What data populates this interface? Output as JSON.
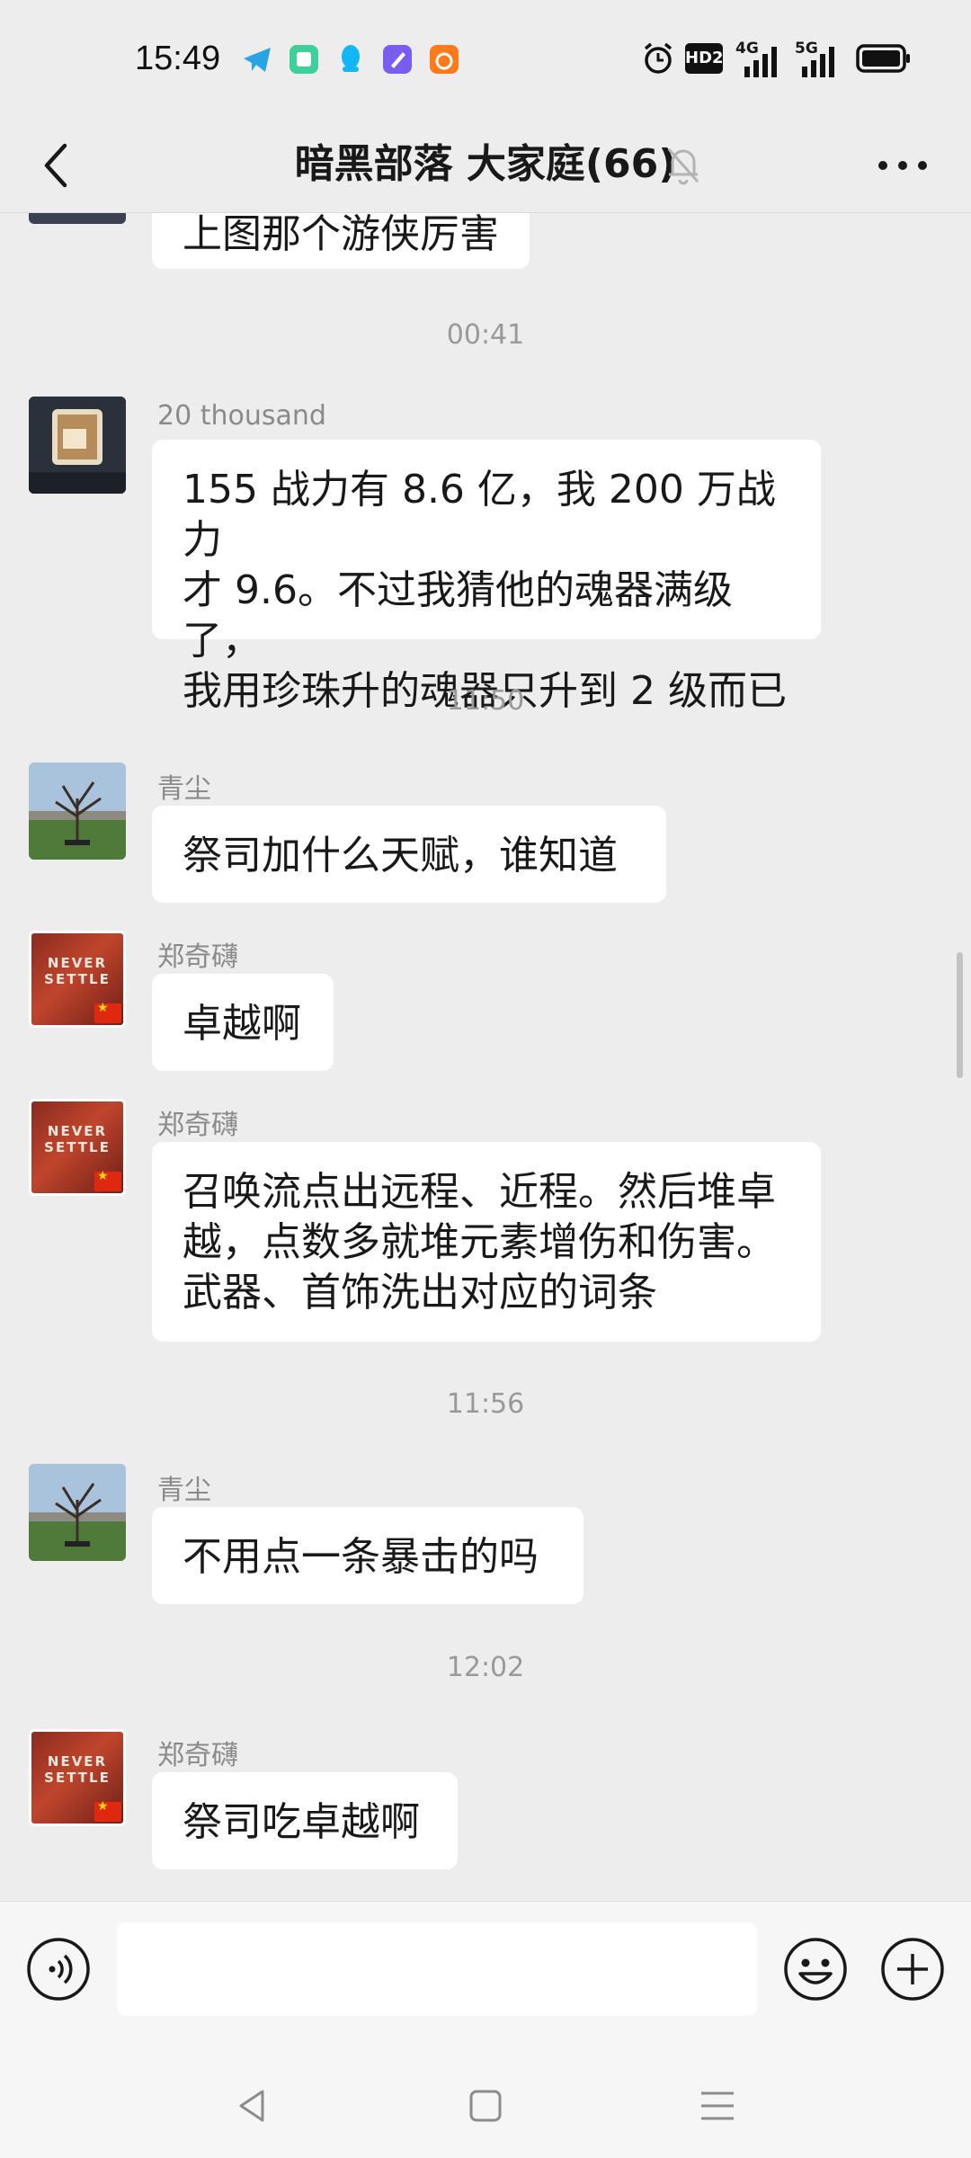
{
  "status_bar": {
    "time": "15:49",
    "hd_label": "HD2",
    "net1": "4G",
    "net2": "5G"
  },
  "header": {
    "title": "暗黑部落 大家庭(66)",
    "back_icon": "chevron-left-icon",
    "mute_icon": "bell-off-icon",
    "more_icon": "more-dots-icon"
  },
  "messages": [
    {
      "type": "text",
      "sender": "",
      "text": "上图那个游侠厉害"
    },
    {
      "type": "time",
      "text": "00:41"
    },
    {
      "type": "text",
      "sender": "20 thousand",
      "text": "155 战力有 8.6 亿，我 200 万战力\n才 9.6。不过我猜他的魂器满级了，\n我用珍珠升的魂器只升到 2 级而已"
    },
    {
      "type": "time",
      "text": "11:50"
    },
    {
      "type": "text",
      "sender": "青尘",
      "text": "祭司加什么天赋，谁知道"
    },
    {
      "type": "text",
      "sender": "郑奇礴",
      "text": "卓越啊"
    },
    {
      "type": "text",
      "sender": "郑奇礴",
      "text": "召唤流点出远程、近程。然后堆卓\n越，点数多就堆元素增伤和伤害。\n武器、首饰洗出对应的词条"
    },
    {
      "type": "time",
      "text": "11:56"
    },
    {
      "type": "text",
      "sender": "青尘",
      "text": "不用点一条暴击的吗"
    },
    {
      "type": "time",
      "text": "12:02"
    },
    {
      "type": "text",
      "sender": "郑奇礴",
      "text": "祭司吃卓越啊"
    }
  ],
  "avatar_text": {
    "line1": "NEVER",
    "line2": "SETTLE"
  },
  "input_bar": {
    "voice_icon": "voice-icon",
    "emoji_icon": "emoji-icon",
    "plus_icon": "plus-icon",
    "message_value": ""
  },
  "nav_bar": {
    "back": "nav-back-icon",
    "home": "nav-home-icon",
    "menu": "nav-menu-icon"
  },
  "colors": {
    "background": "#ededed",
    "bubble": "#ffffff",
    "sender": "#8a8a8a",
    "timestamp": "#999999"
  }
}
